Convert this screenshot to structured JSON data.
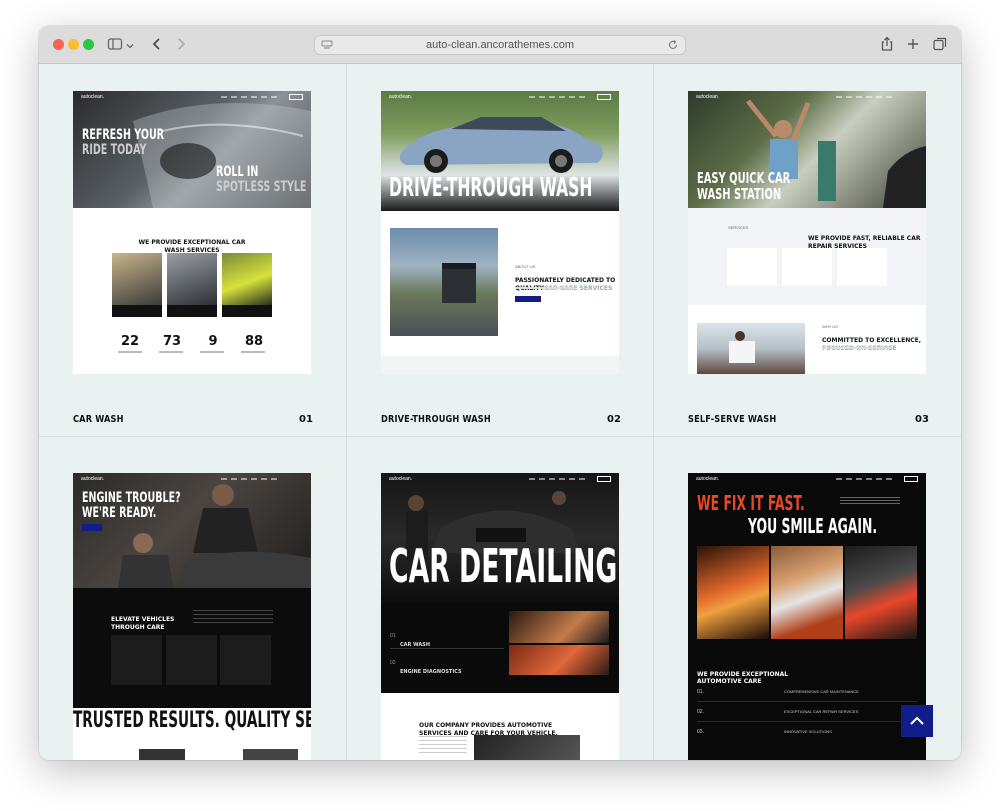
{
  "browser": {
    "url": "auto-clean.ancorathemes.com"
  },
  "cards": [
    {
      "caption": "CAR WASH",
      "number": "01",
      "hero_line1": "REFRESH YOUR",
      "hero_line2": "RIDE TODAY",
      "hero_line3": "ROLL IN",
      "hero_line4": "SPOTLESS STYLE",
      "section_title_1": "WE PROVIDE EXCEPTIONAL CAR",
      "section_title_2": "WASH SERVICES",
      "stats": [
        {
          "value": "22"
        },
        {
          "value": "73"
        },
        {
          "value": "9"
        },
        {
          "value": "88"
        }
      ]
    },
    {
      "caption": "DRIVE-THROUGH WASH",
      "number": "02",
      "hero_title": "DRIVE-THROUGH WASH",
      "side_title_1": "PASSIONATELY DEDICATED TO",
      "side_title_2a": "QUALITY ",
      "side_title_2b": "CAR CARE SERVICES"
    },
    {
      "caption": "SELF-SERVE WASH",
      "number": "03",
      "hero_line1": "EASY QUICK CAR",
      "hero_line2": "WASH STATION",
      "section_title_1": "WE PROVIDE FAST, RELIABLE CAR",
      "section_title_2": "REPAIR SERVICES",
      "side_title_1": "COMMITTED TO EXCELLENCE,",
      "side_title_2": "FOCUSED ON SERVICE"
    },
    {
      "hero_line1": "ENGINE TROUBLE?",
      "hero_line2": "WE'RE READY.",
      "sub_title_1": "ELEVATE VEHICLES",
      "sub_title_2": "THROUGH CARE",
      "banner": "TRUSTED RESULTS.  QUALITY SERVI"
    },
    {
      "hero_title": "CAR DETAILING",
      "list": [
        {
          "num": "01",
          "label": "CAR WASH"
        },
        {
          "num": "02",
          "label": "ENGINE DIAGNOSTICS"
        }
      ],
      "footer_title_1": "OUR COMPANY PROVIDES AUTOMOTIVE",
      "footer_title_2": "SERVICES AND CARE FOR YOUR VEHICLE."
    },
    {
      "hero_line1": "WE FIX IT FAST.",
      "hero_line2": "YOU SMILE AGAIN.",
      "section_title_1": "WE PROVIDE EXCEPTIONAL",
      "section_title_2": "AUTOMOTIVE CARE",
      "list": [
        {
          "num": "01.",
          "label": "COMPREHENSIVE CAR MAINTENANCE"
        },
        {
          "num": "02.",
          "label": "EXCEPTIONAL CAR REPAIR SERVICES"
        },
        {
          "num": "03.",
          "label": "INNOVATIVE SOLUTIONS"
        }
      ]
    }
  ],
  "colors": {
    "accent_blue": "#111d8a",
    "accent_orange": "#e8482a",
    "background": "#eaf1f1"
  }
}
